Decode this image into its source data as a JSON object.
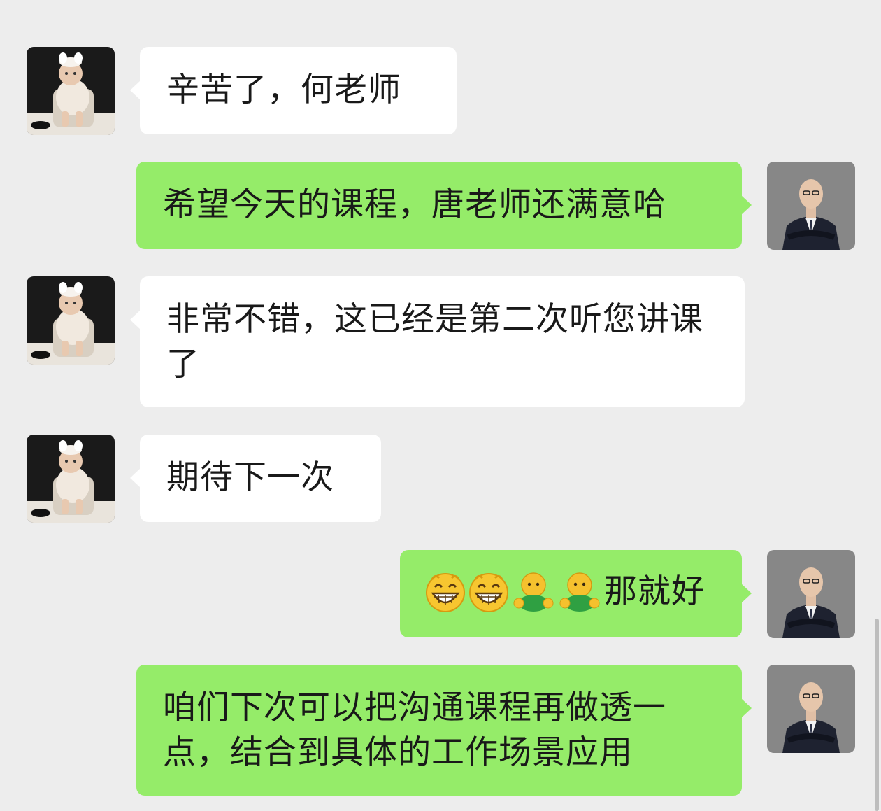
{
  "messages": [
    {
      "sender": "contact",
      "text": "辛苦了，何老师"
    },
    {
      "sender": "self",
      "text": "希望今天的课程，唐老师还满意哈"
    },
    {
      "sender": "contact",
      "text": "非常不错，这已经是第二次听您讲课了"
    },
    {
      "sender": "contact",
      "text": "期待下一次"
    },
    {
      "sender": "self",
      "text": "那就好",
      "emojis": [
        "grin-emoji",
        "grin-emoji",
        "hug-emoji",
        "hug-emoji"
      ]
    },
    {
      "sender": "self",
      "text": "咱们下次可以把沟通课程再做透一点，结合到具体的工作场景应用"
    }
  ],
  "colors": {
    "background": "#ededed",
    "incoming_bubble": "#ffffff",
    "outgoing_bubble": "#95ec69",
    "text": "#191919"
  },
  "avatars": {
    "contact": "baby-photo-avatar",
    "self": "man-in-suit-avatar"
  }
}
